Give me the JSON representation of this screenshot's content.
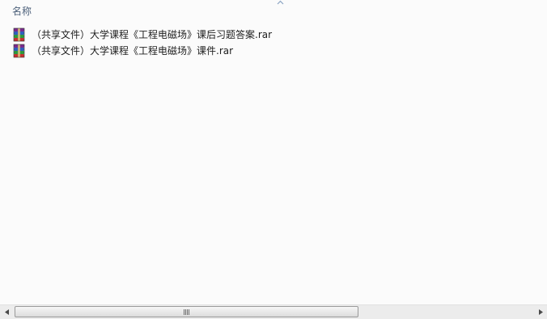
{
  "header": {
    "name_column": "名称",
    "sort": "ascending"
  },
  "files": [
    {
      "name": "（共享文件）大学课程《工程电磁场》课后习题答案.rar",
      "icon": "winrar-archive-icon"
    },
    {
      "name": "（共享文件）大学课程《工程电磁场》课件.rar",
      "icon": "winrar-archive-icon"
    }
  ],
  "scrollbar": {
    "orientation": "horizontal",
    "thumb_fraction": 0.66,
    "position": 0.0
  },
  "colors": {
    "header_text": "#4c607a",
    "background": "#fbfbfb"
  }
}
